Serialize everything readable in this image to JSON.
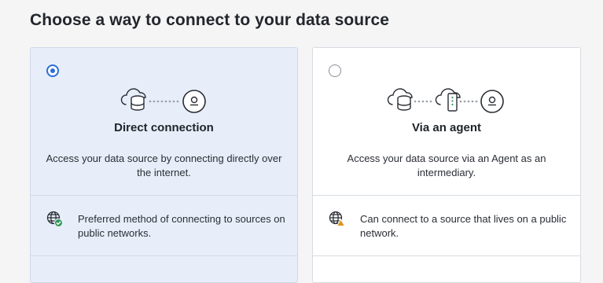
{
  "page": {
    "heading": "Choose a way to connect to your data source"
  },
  "options": [
    {
      "title": "Direct connection",
      "description": "Access your data source by connecting directly over the internet.",
      "feature": "Preferred method of connecting to sources on public networks.",
      "selected": true,
      "feature_icon": "globe-check-icon"
    },
    {
      "title": "Via an agent",
      "description": "Access your data source via an Agent as an intermediary.",
      "feature": "Can connect to a source that lives on a public network.",
      "selected": false,
      "feature_icon": "globe-warning-icon"
    }
  ],
  "colors": {
    "selected_card_bg": "#e7eef9",
    "radio_accent": "#2d6fd6",
    "check_badge": "#2f9a5a",
    "warning_badge": "#e0941f"
  }
}
